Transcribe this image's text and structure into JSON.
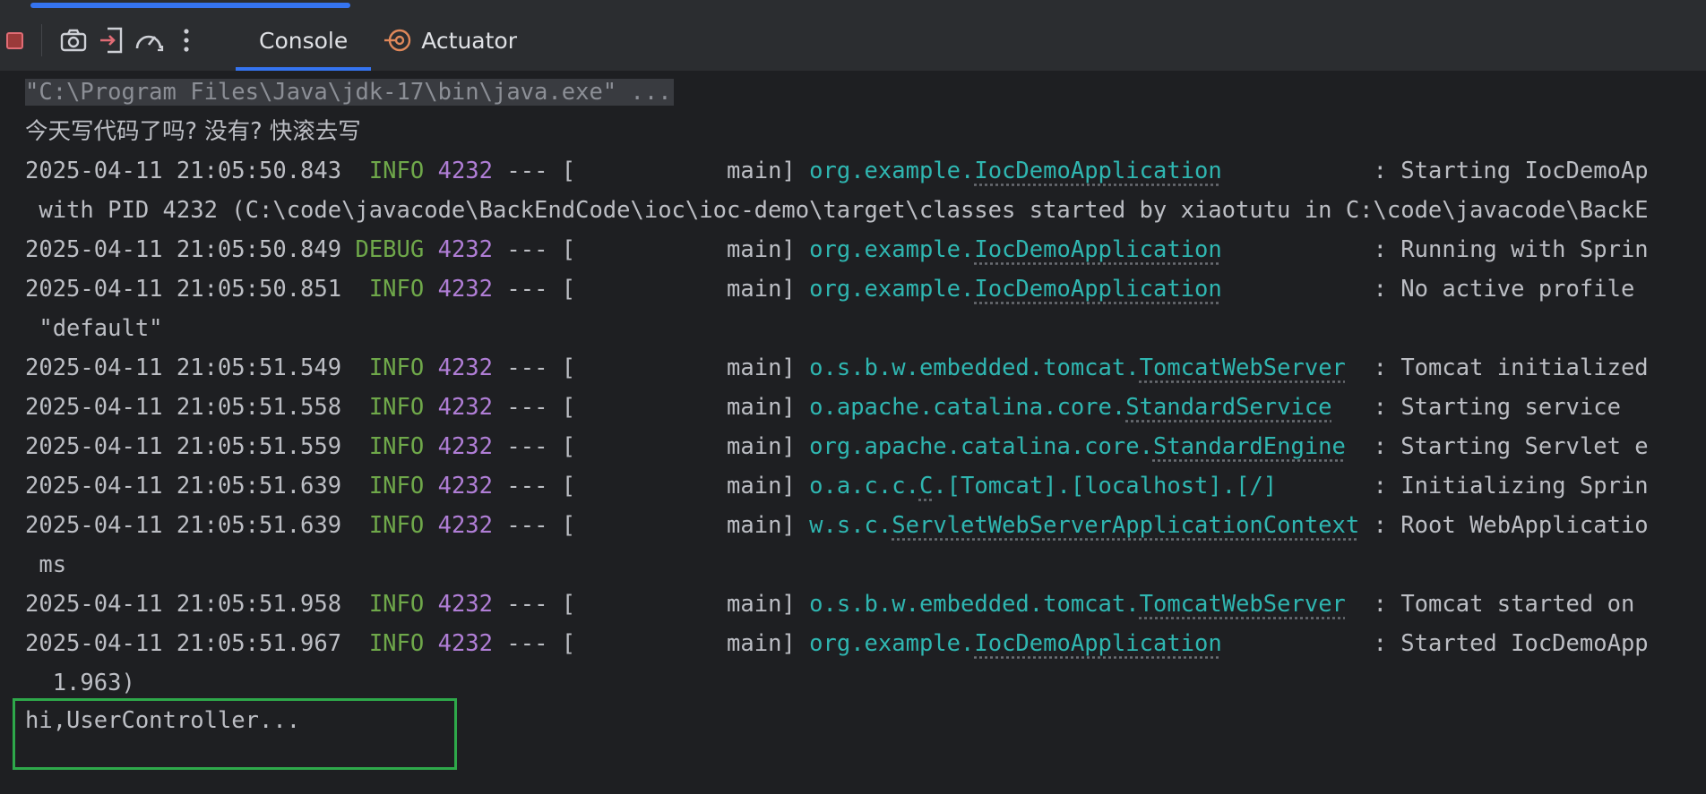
{
  "toolbar": {
    "tabs": [
      {
        "label": "Console",
        "active": true
      },
      {
        "label": "Actuator",
        "active": false
      }
    ],
    "icons": [
      "stop-icon",
      "camera-icon",
      "exit-icon",
      "speedometer-icon",
      "more-vert-icon",
      "actuator-icon"
    ]
  },
  "colors": {
    "info": "#6fa84a",
    "pid": "#b07ed6",
    "logger": "#2fb6b1",
    "accent": "#3574f0",
    "highlight_box": "#2ea84a"
  },
  "console": {
    "command": "\"C:\\Program Files\\Java\\jdk-17\\bin\\java.exe\" ...",
    "banner": "今天写代码了吗? 没有? 快滚去写",
    "logs": [
      {
        "ts": "2025-04-11 21:05:50.843",
        "level": " INFO",
        "pid": "4232",
        "sep": " --- [",
        "thread": "           main] ",
        "pkg": "org.example.",
        "cls": "IocDemoApplication",
        "pad": "          ",
        "msg": " : Starting IocDemoAp",
        "cont": " with PID 4232 (C:\\code\\javacode\\BackEndCode\\ioc\\ioc-demo\\target\\classes started by xiaotutu in C:\\code\\javacode\\BackE"
      },
      {
        "ts": "2025-04-11 21:05:50.849",
        "level": "DEBUG",
        "pid": "4232",
        "sep": " --- [",
        "thread": "           main] ",
        "pkg": "org.example.",
        "cls": "IocDemoApplication",
        "pad": "          ",
        "msg": " : Running with Sprin"
      },
      {
        "ts": "2025-04-11 21:05:50.851",
        "level": " INFO",
        "pid": "4232",
        "sep": " --- [",
        "thread": "           main] ",
        "pkg": "org.example.",
        "cls": "IocDemoApplication",
        "pad": "          ",
        "msg": " : No active profile",
        "cont": " \"default\""
      },
      {
        "ts": "2025-04-11 21:05:51.549",
        "level": " INFO",
        "pid": "4232",
        "sep": " --- [",
        "thread": "           main] ",
        "pkg": "o.s.b.w.embedded.tomcat.",
        "cls": "TomcatWebServer",
        "pad": " ",
        "msg": " : Tomcat initialized"
      },
      {
        "ts": "2025-04-11 21:05:51.558",
        "level": " INFO",
        "pid": "4232",
        "sep": " --- [",
        "thread": "           main] ",
        "pkg": "o.apache.catalina.core.",
        "cls": "StandardService",
        "pad": "  ",
        "msg": " : Starting service"
      },
      {
        "ts": "2025-04-11 21:05:51.559",
        "level": " INFO",
        "pid": "4232",
        "sep": " --- [",
        "thread": "           main] ",
        "pkg": "org.apache.catalina.core.",
        "cls": "StandardEngine",
        "pad": " ",
        "msg": " : Starting Servlet e"
      },
      {
        "ts": "2025-04-11 21:05:51.639",
        "level": " INFO",
        "pid": "4232",
        "sep": " --- [",
        "thread": "           main] ",
        "pkg": "o.a.c.c.",
        "cls": "C",
        "pkg2": ".[Tomcat].[localhost].[/]",
        "pad": "      ",
        "msg": " : Initializing Sprin"
      },
      {
        "ts": "2025-04-11 21:05:51.639",
        "level": " INFO",
        "pid": "4232",
        "sep": " --- [",
        "thread": "           main] ",
        "pkg": "w.s.c.",
        "cls": "ServletWebServerApplicationContext",
        "pad": "",
        "msg": " : Root WebApplicatio",
        "cont": " ms"
      },
      {
        "ts": "2025-04-11 21:05:51.958",
        "level": " INFO",
        "pid": "4232",
        "sep": " --- [",
        "thread": "           main] ",
        "pkg": "o.s.b.w.embedded.tomcat.",
        "cls": "TomcatWebServer",
        "pad": " ",
        "msg": " : Tomcat started on"
      },
      {
        "ts": "2025-04-11 21:05:51.967",
        "level": " INFO",
        "pid": "4232",
        "sep": " --- [",
        "thread": "           main] ",
        "pkg": "org.example.",
        "cls": "IocDemoApplication",
        "pad": "          ",
        "msg": " : Started IocDemoApp",
        "cont": "  1.963)"
      }
    ],
    "output": "hi,UserController..."
  }
}
